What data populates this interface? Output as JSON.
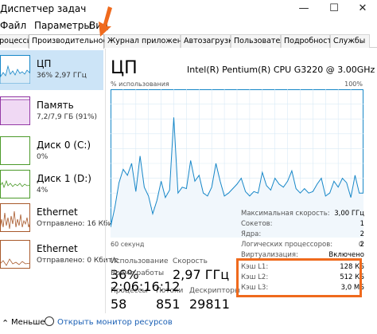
{
  "app": {
    "title": "Диспетчер задач"
  },
  "window_controls": {
    "minimize": "—",
    "maximize": "☐",
    "close": "✕"
  },
  "menu": [
    "Файл",
    "Параметры",
    "Вид"
  ],
  "tabs": [
    "Процессы",
    "Производительность",
    "Журнал приложений",
    "Автозагрузка",
    "Пользователи",
    "Подробности",
    "Службы"
  ],
  "active_tab": 1,
  "sidebar": {
    "items": [
      {
        "name": "ЦП",
        "sub": "36% 2,97 ГГц",
        "color": "#1787c8",
        "selected": true
      },
      {
        "name": "Память",
        "sub": "7,2/7,9 ГБ (91%)",
        "color": "#8b2a9e",
        "selected": false
      },
      {
        "name": "Диск 0 (C:)",
        "sub": "0%",
        "color": "#4c9a2a",
        "selected": false
      },
      {
        "name": "Диск 1 (D:)",
        "sub": "4%",
        "color": "#4c9a2a",
        "selected": false
      },
      {
        "name": "Ethernet",
        "sub": "Отправлено: 16 Кбит/с",
        "color": "#a8592b",
        "selected": false
      },
      {
        "name": "Ethernet",
        "sub": "Отправлено: 0 Кбит/с",
        "color": "#a8592b",
        "selected": false
      }
    ]
  },
  "cpu": {
    "title": "ЦП",
    "model": "Intel(R) Pentium(R) CPU G3220 @ 3.00GHz",
    "util_label": "% использования",
    "util_max": "100%",
    "time_left": "60 секунд",
    "time_right": "0",
    "graph_values": [
      7,
      20,
      37,
      46,
      42,
      50,
      31,
      55,
      34,
      28,
      16,
      25,
      38,
      27,
      32,
      35,
      30,
      34,
      33,
      52,
      38,
      42,
      30,
      28,
      34,
      31,
      38,
      28,
      30,
      33,
      36,
      40,
      31,
      28,
      31,
      30,
      44,
      35,
      32,
      39,
      36,
      34,
      38,
      45,
      33,
      30,
      33,
      30,
      31,
      36,
      40,
      28,
      30,
      38,
      34,
      40,
      37,
      27,
      42,
      30,
      30
    ],
    "graph_peaks": [
      {
        "i": 15,
        "v": 81
      },
      {
        "i": 25,
        "v": 50
      },
      {
        "i": 39,
        "v": 40
      }
    ]
  },
  "stats": {
    "utilization_label": "Использование",
    "utilization": "36%",
    "speed_label": "Скорость",
    "speed": "2,97 ГГц",
    "processes_label": "Процессы",
    "processes": "58",
    "threads_label": "Потоки",
    "threads": "851",
    "handles_label": "Дескрипторы",
    "handles": "29811",
    "uptime_label": "Время работы",
    "uptime": "2:06:16:12"
  },
  "details": [
    {
      "label": "Максимальная скорость:",
      "value": "3,00 ГГц"
    },
    {
      "label": "Сокетов:",
      "value": "1"
    },
    {
      "label": "Ядра:",
      "value": "2"
    },
    {
      "label": "Логических процессоров:",
      "value": "2"
    },
    {
      "label": "Виртуализация:",
      "value": "Включено"
    },
    {
      "label": "Кэш L1:",
      "value": "128 КБ"
    },
    {
      "label": "Кэш L2:",
      "value": "512 КБ"
    },
    {
      "label": "Кэш L3:",
      "value": "3,0 МБ"
    }
  ],
  "statusbar": {
    "less": "Меньше",
    "monitor": "Открыть монитор ресурсов"
  },
  "colors": {
    "accent": "#1787c8",
    "highlight": "#ef6a1d",
    "graph_fill": "#f1f7fc",
    "graph_line": "#1787c8"
  }
}
